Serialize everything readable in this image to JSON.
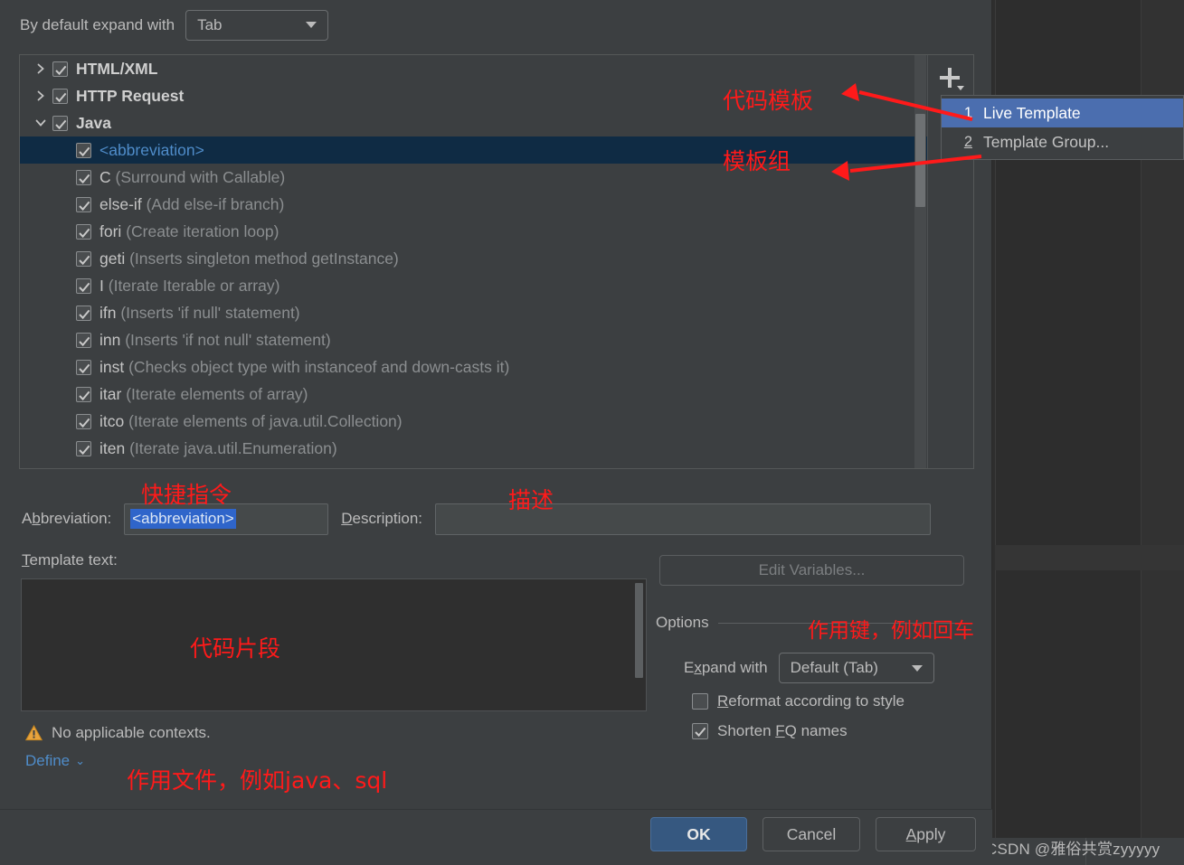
{
  "dialog": {
    "top_row": {
      "label": "By default expand with",
      "combo_value": "Tab"
    },
    "tree": {
      "items": [
        {
          "indent": 1,
          "twisty": "collapsed",
          "checked": true,
          "name": "HTML/XML",
          "bold": true
        },
        {
          "indent": 1,
          "twisty": "collapsed",
          "checked": true,
          "name": "HTTP Request",
          "bold": true
        },
        {
          "indent": 1,
          "twisty": "expanded",
          "checked": true,
          "name": "Java",
          "bold": true
        },
        {
          "indent": 2,
          "checked": true,
          "abbrev": "<abbreviation>",
          "selected": true
        },
        {
          "indent": 2,
          "checked": true,
          "key": "C",
          "desc": "(Surround with Callable)"
        },
        {
          "indent": 2,
          "checked": true,
          "key": "else-if",
          "desc": "(Add else-if branch)"
        },
        {
          "indent": 2,
          "checked": true,
          "key": "fori",
          "desc": "(Create iteration loop)"
        },
        {
          "indent": 2,
          "checked": true,
          "key": "geti",
          "desc": "(Inserts singleton method getInstance)"
        },
        {
          "indent": 2,
          "checked": true,
          "key": "I",
          "desc": "(Iterate Iterable or array)"
        },
        {
          "indent": 2,
          "checked": true,
          "key": "ifn",
          "desc": "(Inserts 'if null' statement)"
        },
        {
          "indent": 2,
          "checked": true,
          "key": "inn",
          "desc": "(Inserts 'if not null' statement)"
        },
        {
          "indent": 2,
          "checked": true,
          "key": "inst",
          "desc": "(Checks object type with instanceof and down-casts it)"
        },
        {
          "indent": 2,
          "checked": true,
          "key": "itar",
          "desc": "(Iterate elements of array)"
        },
        {
          "indent": 2,
          "checked": true,
          "key": "itco",
          "desc": "(Iterate elements of java.util.Collection)"
        },
        {
          "indent": 2,
          "checked": true,
          "key": "iten",
          "desc": "(Iterate java.util.Enumeration)"
        }
      ],
      "toolbar": {
        "add_icon": "plus-icon",
        "revert_icon": "revert-arrow-icon"
      }
    },
    "popup_menu": {
      "items": [
        {
          "number": "1",
          "label": "Live Template",
          "selected": true
        },
        {
          "number": "2",
          "label": "Template Group...",
          "selected": false
        }
      ]
    },
    "abbreviation": {
      "label": "Abbreviation:",
      "value": "<abbreviation>",
      "selected_text": true
    },
    "description": {
      "label": "Description:",
      "value": ""
    },
    "template_text": {
      "label": "Template text:",
      "value": ""
    },
    "edit_variables_button": "Edit Variables...",
    "options": {
      "title": "Options",
      "expand_with": {
        "label": "Expand with",
        "value": "Default (Tab)"
      },
      "reformat": {
        "label": "Reformat according to style",
        "checked": false
      },
      "shorten_fq": {
        "label": "Shorten FQ names",
        "checked": true
      }
    },
    "context": {
      "warning_icon": "warning-triangle-icon",
      "warning_text": "No applicable contexts.",
      "define_link": "Define"
    },
    "buttons": {
      "ok": "OK",
      "cancel": "Cancel",
      "apply": "Apply"
    }
  },
  "annotations": {
    "code_template": "代码模板",
    "template_group": "模板组",
    "shortcut_command": "快捷指令",
    "description": "描述",
    "code_snippet": "代码片段",
    "action_key": "作用键，例如回车",
    "applicable_file": "作用文件，例如java、sql",
    "color": "#ff1a1a"
  },
  "watermark": "CSDN @雅俗共赏zyyyyy",
  "colors": {
    "dialog_bg": "#3c3f41",
    "selection_blue": "#4b6eaf",
    "tree_selection": "#0f2b44",
    "accent_link": "#4f8cc9",
    "ok_button": "#365880",
    "text_field_selection": "#2f65ca"
  }
}
